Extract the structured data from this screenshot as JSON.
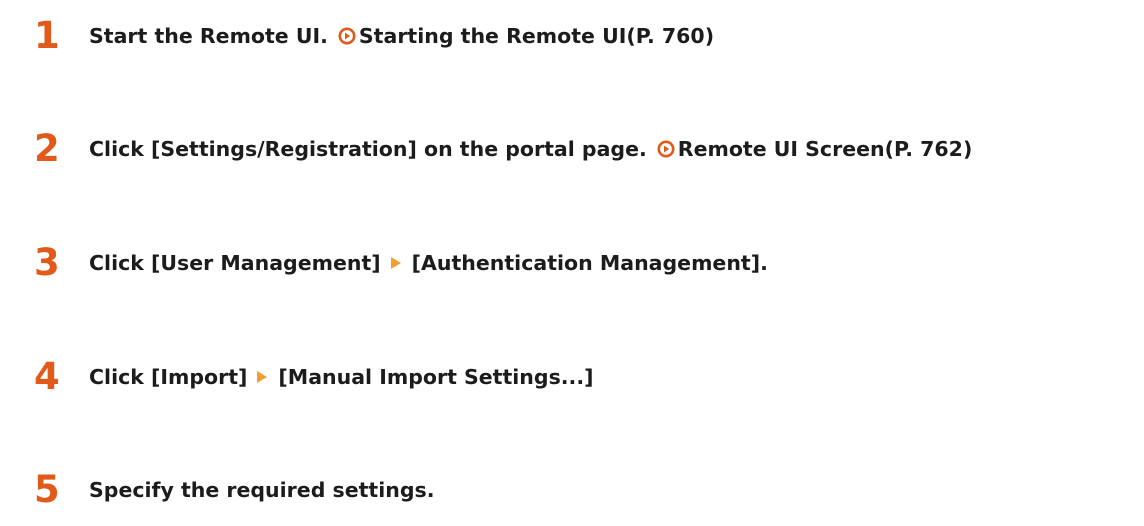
{
  "colors": {
    "step_number": "#e15a19",
    "text": "#1c1c1c",
    "link_icon": "#e15a19",
    "menu_arrow": "#f0a030"
  },
  "steps": [
    {
      "number": "1",
      "text": "Start the Remote UI.",
      "link": {
        "icon": "circle-play-icon",
        "label": "Starting the Remote UI(P. 760)"
      }
    },
    {
      "number": "2",
      "text": "Click [Settings/Registration] on the portal page.",
      "link": {
        "icon": "circle-play-icon",
        "label": "Remote UI Screen(P. 762)"
      }
    },
    {
      "number": "3",
      "text_before": "Click [User Management]",
      "arrow_icon": "triangle-right-icon",
      "text_after": "[Authentication Management]."
    },
    {
      "number": "4",
      "text_before": "Click [Import]",
      "arrow_icon": "triangle-right-icon",
      "text_after": "[Manual Import Settings...]"
    },
    {
      "number": "5",
      "text": "Specify the required settings."
    }
  ]
}
